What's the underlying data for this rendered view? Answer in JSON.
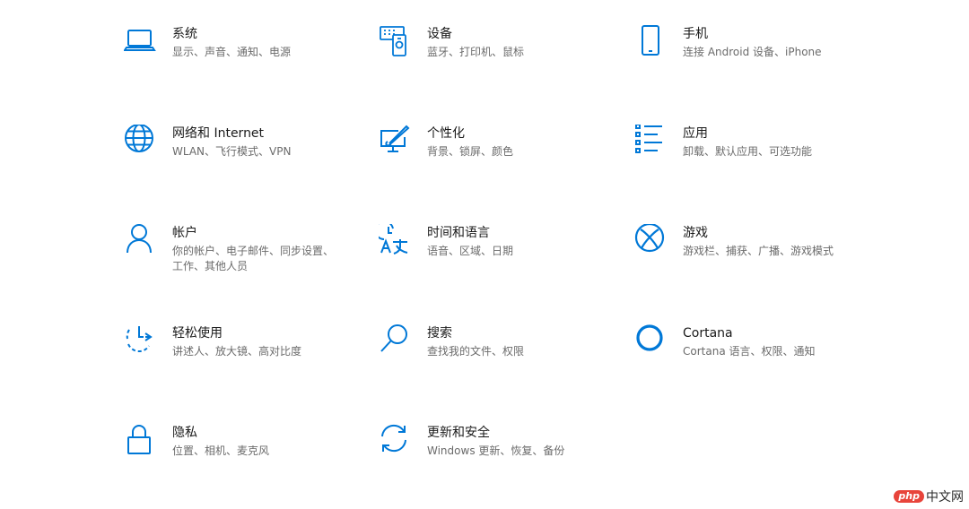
{
  "colors": {
    "accent": "#0078d7",
    "title": "#1a1a1a",
    "description": "#6b6b6b"
  },
  "tiles": [
    {
      "title": "系统",
      "desc": "显示、声音、通知、电源",
      "icon": "laptop-icon"
    },
    {
      "title": "设备",
      "desc": "蓝牙、打印机、鼠标",
      "icon": "devices-icon"
    },
    {
      "title": "手机",
      "desc": "连接 Android 设备、iPhone",
      "icon": "phone-icon"
    },
    {
      "title": "网络和 Internet",
      "desc": "WLAN、飞行模式、VPN",
      "icon": "globe-icon"
    },
    {
      "title": "个性化",
      "desc": "背景、锁屏、颜色",
      "icon": "personalization-icon"
    },
    {
      "title": "应用",
      "desc": "卸载、默认应用、可选功能",
      "icon": "apps-list-icon"
    },
    {
      "title": "帐户",
      "desc": "你的帐户、电子邮件、同步设置、工作、其他人员",
      "icon": "person-icon"
    },
    {
      "title": "时间和语言",
      "desc": "语音、区域、日期",
      "icon": "time-language-icon"
    },
    {
      "title": "游戏",
      "desc": "游戏栏、捕获、广播、游戏模式",
      "icon": "xbox-icon"
    },
    {
      "title": "轻松使用",
      "desc": "讲述人、放大镜、高对比度",
      "icon": "ease-of-access-icon"
    },
    {
      "title": "搜索",
      "desc": "查找我的文件、权限",
      "icon": "search-icon"
    },
    {
      "title": "Cortana",
      "desc": "Cortana 语言、权限、通知",
      "icon": "cortana-ring-icon"
    },
    {
      "title": "隐私",
      "desc": "位置、相机、麦克风",
      "icon": "lock-icon"
    },
    {
      "title": "更新和安全",
      "desc": "Windows 更新、恢复、备份",
      "icon": "sync-icon"
    }
  ],
  "watermark": {
    "logo": "php",
    "text": "中文网"
  }
}
